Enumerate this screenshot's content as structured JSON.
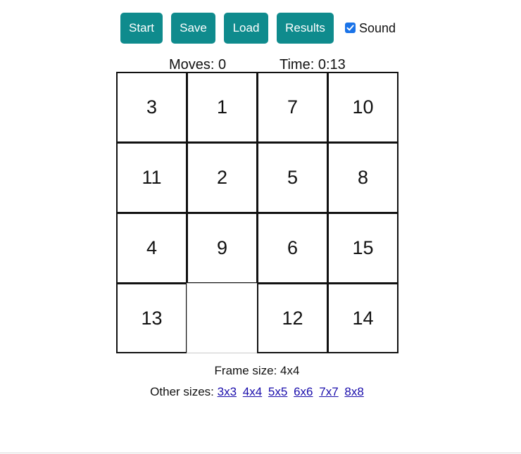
{
  "toolbar": {
    "start_label": "Start",
    "save_label": "Save",
    "load_label": "Load",
    "results_label": "Results",
    "sound_label": "Sound",
    "sound_checked": true
  },
  "colors": {
    "button_bg": "#0f8b8d",
    "checkbox_bg": "#1a73e8",
    "link": "#1a0dab"
  },
  "stats": {
    "moves": "Moves: 0",
    "time": "Time: 0:13"
  },
  "board": {
    "size": 4,
    "tiles": [
      [
        "3",
        "1",
        "7",
        "10"
      ],
      [
        "11",
        "2",
        "5",
        "8"
      ],
      [
        "4",
        "9",
        "6",
        "15"
      ],
      [
        "13",
        "",
        "12",
        "14"
      ]
    ]
  },
  "footer": {
    "frame_size": "Frame size: 4x4",
    "other_sizes_label": "Other sizes:",
    "size_links": [
      "3x3",
      "4x4",
      "5x5",
      "6x6",
      "7x7",
      "8x8"
    ]
  }
}
